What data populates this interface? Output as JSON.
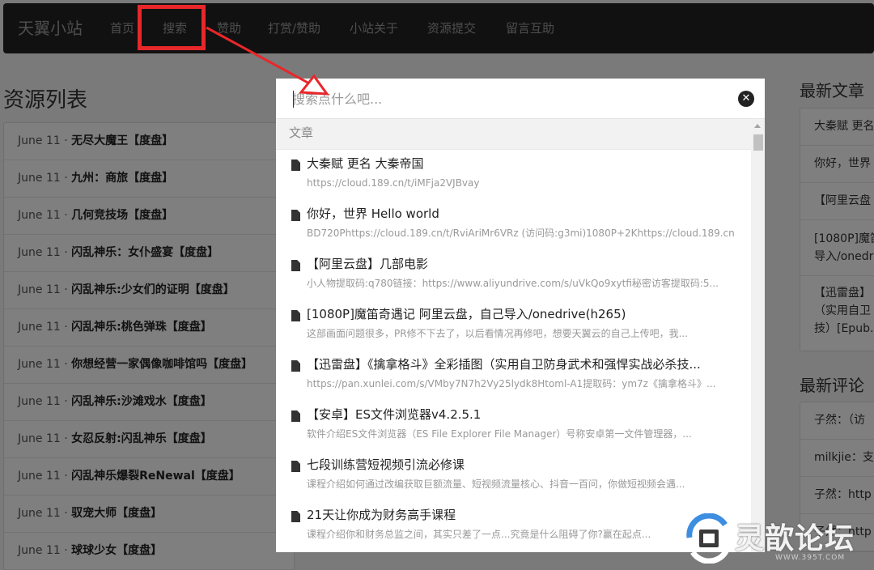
{
  "navbar": {
    "brand": "天翼小站",
    "items": [
      "首页",
      "搜索",
      "赞助",
      "打赏/赞助",
      "小站关于",
      "资源提交",
      "留言互助"
    ]
  },
  "left": {
    "title": "资源列表",
    "rows": [
      {
        "date": "June 11 · ",
        "title": "无尽大魔王【度盘】"
      },
      {
        "date": "June 11 · ",
        "title": "九州：商旅【度盘】"
      },
      {
        "date": "June 11 · ",
        "title": "几何竞技场【度盘】"
      },
      {
        "date": "June 11 · ",
        "title": "闪乱神乐：女仆盛宴【度盘】"
      },
      {
        "date": "June 11 · ",
        "title": "闪乱神乐:少女们的证明【度盘】"
      },
      {
        "date": "June 11 · ",
        "title": "闪乱神乐:桃色弹珠【度盘】"
      },
      {
        "date": "June 11 · ",
        "title": "你想经营一家偶像咖啡馆吗【度盘】"
      },
      {
        "date": "June 11 · ",
        "title": "闪乱神乐:沙滩戏水【度盘】"
      },
      {
        "date": "June 11 · ",
        "title": "女忍反射:闪乱神乐【度盘】"
      },
      {
        "date": "June 11 · ",
        "title": "闪乱神乐爆裂ReNewal【度盘】"
      },
      {
        "date": "June 11 · ",
        "title": "驭宠大师【度盘】"
      },
      {
        "date": "June 11 · ",
        "title": "球球少女【度盘】"
      }
    ]
  },
  "right": {
    "latest_title": "最新文章",
    "latest": [
      "大秦赋 更名",
      "你好，世界",
      "【阿里云盘",
      "[1080P]魔笛",
      "导入/onedr",
      "【迅雷盘】",
      "（实用自卫",
      "技）[Epub."
    ],
    "comments_title": "最新评论",
    "comments": [
      "子然：（访",
      "milkjie：支",
      "子然：http",
      "子然：http"
    ]
  },
  "search": {
    "placeholder": "搜索点什么吧...",
    "close": "✕",
    "category": "文章",
    "results": [
      {
        "title": "大秦赋 更名 大秦帝国",
        "snippet": "https://cloud.189.cn/t/iMFja2VJBvay"
      },
      {
        "title": "你好，世界 Hello world",
        "snippet": "BD720Phttps://cloud.189.cn/t/RviAriMr6VRz (访问码:g3mi)1080P+2Khttps://cloud.189.cn"
      },
      {
        "title": "【阿里云盘】几部电影",
        "snippet": "小人物提取码:q780链接：https://www.aliyundrive.com/s/uVkQo9xytfi秘密访客提取码:5..."
      },
      {
        "title": "[1080P]魔笛奇遇记 阿里云盘，自己导入/onedrive(h265)",
        "snippet": "这部画面问题很多，PR修不下去了，以后看情况再修吧，想要天翼云的自己上传吧，我..."
      },
      {
        "title": "【迅雷盘】《擒拿格斗》全彩插图（实用自卫防身武术和强悍实战必杀技...",
        "snippet": "https://pan.xunlei.com/s/VMby7N7h2Vy25lydk8Htoml-A1提取码：ym7z《擒拿格斗》..."
      },
      {
        "title": "【安卓】ES文件浏览器v4.2.5.1",
        "snippet": "软件介绍ES文件浏览器（ES File Explorer File Manager）号称安卓第一文件管理器，..."
      },
      {
        "title": "七段训练营短视频引流必修课",
        "snippet": "课程介绍如何通过改编获取巨额流量、短视频流量核心、抖音一百问，你做短视频会遇..."
      },
      {
        "title": "21天让你成为财务高手课程",
        "snippet": "课程介绍你和财务总监之间，其实只差了一点...究竟是什么阻碍了你?赢在起点..."
      }
    ]
  },
  "watermark": {
    "text": "灵歆论坛",
    "url": "WWW.395T.COM"
  },
  "colors": {
    "highlight": "#e8272a",
    "navbar": "#222222"
  }
}
